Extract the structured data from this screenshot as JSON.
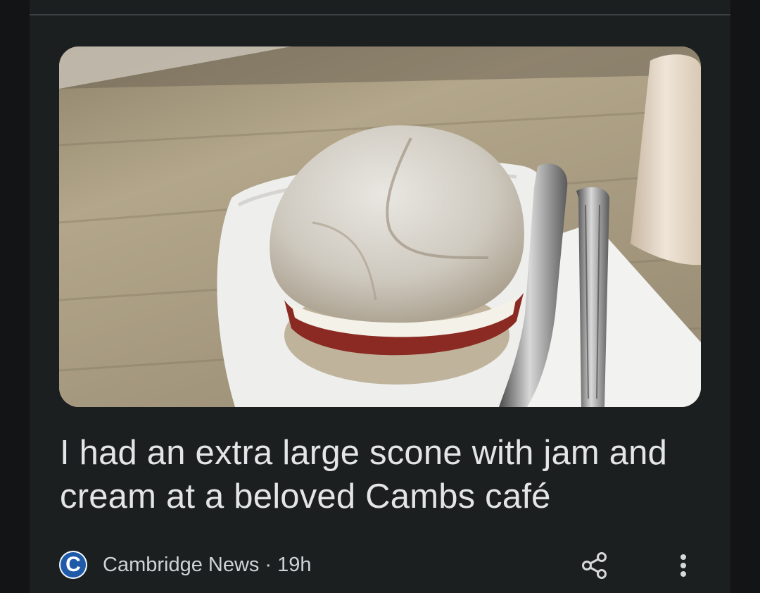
{
  "article": {
    "headline": "I had an extra large scone with jam and cream at a beloved Cambs café",
    "image_alt": "Extra large scone with jam and cream on a white plate beside a knife and fork",
    "source": {
      "logo_letter": "C",
      "name": "Cambridge News",
      "separator": "·",
      "age": "19h"
    }
  },
  "actions": {
    "share_icon": "share-icon",
    "more_icon": "more-vertical-icon"
  },
  "colors": {
    "background": "#121415",
    "card": "#1b1f20",
    "text": "#e3e5e6",
    "meta_text": "#d0d3d5",
    "source_logo": "#1e5aa8"
  }
}
